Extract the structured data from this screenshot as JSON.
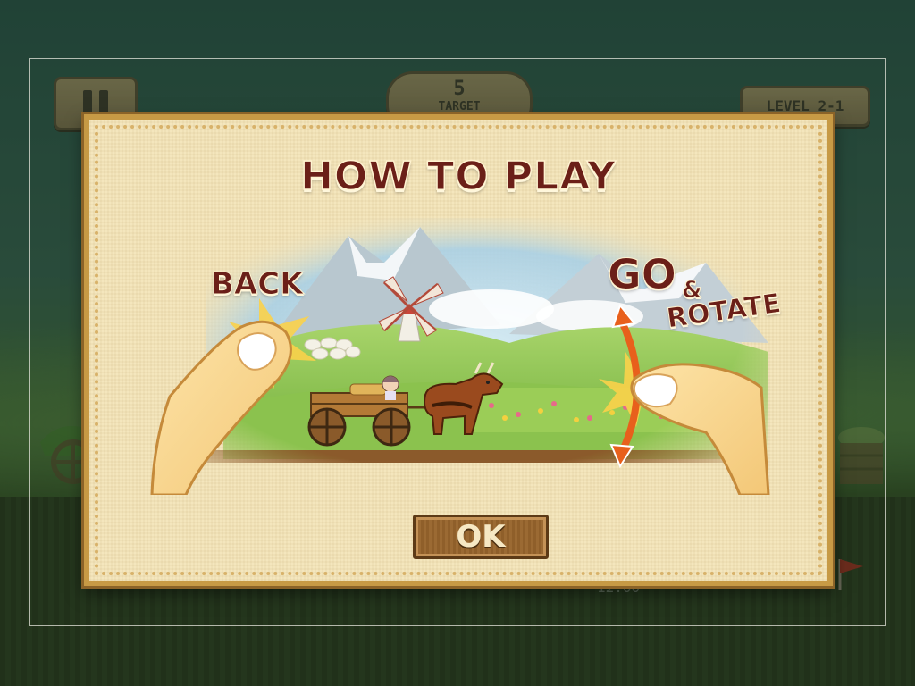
{
  "hud": {
    "target_value": "5",
    "target_label": "TARGET",
    "level_label": "LEVEL 2-1",
    "timer_text": "12:00"
  },
  "dialog": {
    "title": "HOW TO PLAY",
    "back_label": "BACK",
    "go_label": "GO",
    "ampersand": "&",
    "rotate_label": "ROTATE",
    "ok_label": "OK"
  },
  "colors": {
    "title_text": "#6b1f18",
    "dialog_bg": "#f4e6bd",
    "dialog_border": "#c79a45",
    "ok_button_bg": "#8f5f2a",
    "arrow_orange": "#e8601c"
  },
  "icons": [
    "pause-icon",
    "finish-flag-icon",
    "clock-icon",
    "rotate-arrow-icon",
    "tap-burst-icon"
  ]
}
